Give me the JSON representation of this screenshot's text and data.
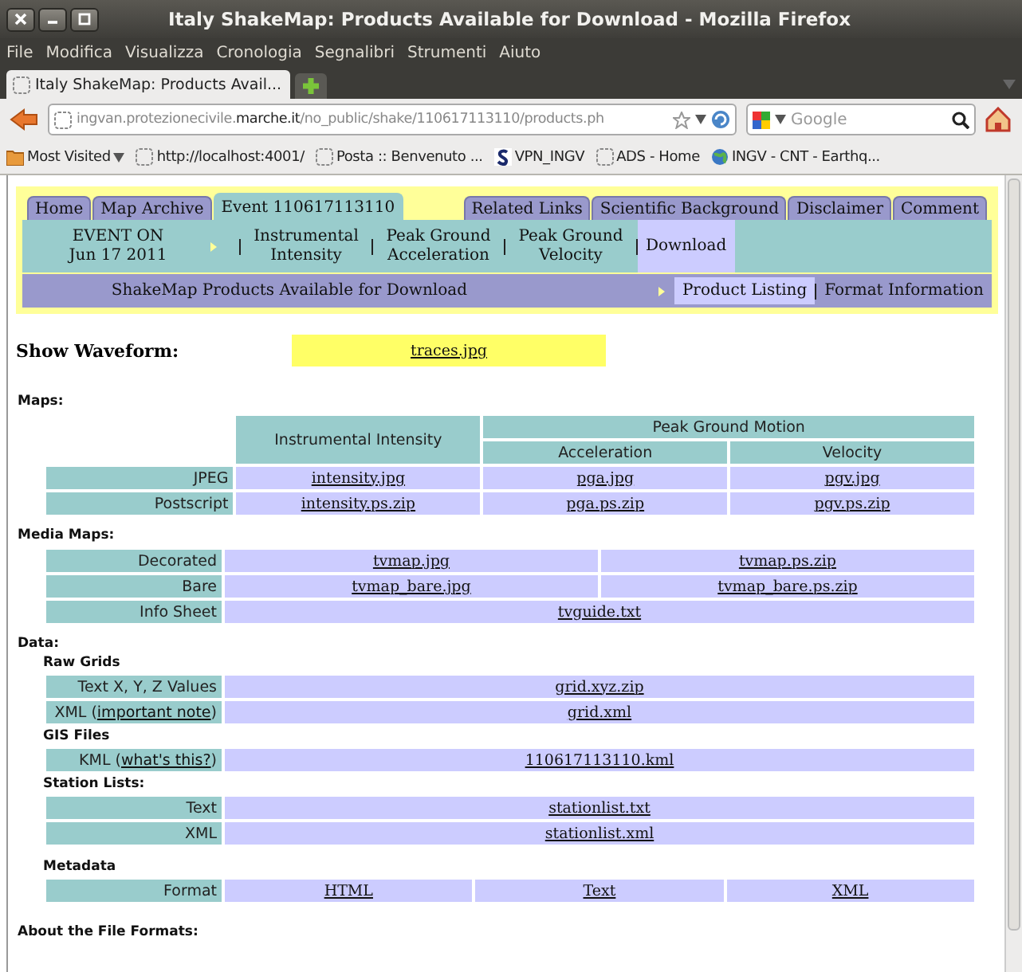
{
  "window": {
    "title": "Italy ShakeMap: Products Available for Download - Mozilla Firefox"
  },
  "menu": [
    "File",
    "Modifica",
    "Visualizza",
    "Cronologia",
    "Segnalibri",
    "Strumenti",
    "Aiuto"
  ],
  "browser_tabs": [
    {
      "label": "Italy ShakeMap: Products Avail...",
      "selected": true
    }
  ],
  "address": {
    "prefix": "ingvan.protezionecivile.",
    "domain": "marche.it",
    "path": "/no_public/shake/110617113110/products.ph"
  },
  "search": {
    "placeholder": "Google"
  },
  "bookmarks": [
    {
      "label": "Most Visited",
      "kind": "folder"
    },
    {
      "label": "http://localhost:4001/",
      "kind": "page"
    },
    {
      "label": "Posta :: Benvenuto ...",
      "kind": "page"
    },
    {
      "label": "VPN_INGV",
      "kind": "vpn"
    },
    {
      "label": "ADS - Home",
      "kind": "page"
    },
    {
      "label": "INGV - CNT - Earthq...",
      "kind": "globe"
    }
  ],
  "site_tabs": {
    "left": [
      {
        "label": "Home",
        "selected": false
      },
      {
        "label": "Map Archive",
        "selected": false
      },
      {
        "label": "Event 110617113110",
        "selected": true
      }
    ],
    "right": [
      {
        "label": "Related Links",
        "selected": false
      },
      {
        "label": "Scientific Background",
        "selected": false
      },
      {
        "label": "Disclaimer",
        "selected": false
      },
      {
        "label": "Comment",
        "selected": false
      }
    ]
  },
  "event_nav": {
    "event_lines": [
      "EVENT ON",
      "Jun 17 2011"
    ],
    "items": [
      {
        "label": "Instrumental Intensity",
        "selected": false
      },
      {
        "label": "Peak Ground Acceleration",
        "selected": false
      },
      {
        "label": "Peak Ground Velocity",
        "selected": false
      },
      {
        "label": "Download",
        "selected": true
      }
    ]
  },
  "sub_nav": {
    "title": "ShakeMap Products Available for Download",
    "items": [
      {
        "label": "Product Listing",
        "selected": true
      },
      {
        "label": "Format Information",
        "selected": false
      }
    ]
  },
  "waveform": {
    "label": "Show Waveform:",
    "link": "traces.jpg"
  },
  "maps": {
    "heading": "Maps:",
    "header": {
      "first": "Instrumental Intensity",
      "group": "Peak Ground Motion",
      "sub": [
        "Acceleration",
        "Velocity"
      ]
    },
    "rows": [
      {
        "label": [
          {
            "text": "JPEG"
          }
        ],
        "links": [
          "intensity.jpg",
          "pga.jpg",
          "pgv.jpg"
        ]
      },
      {
        "label": [
          {
            "text": "Postscript"
          }
        ],
        "links": [
          "intensity.ps.zip",
          "pga.ps.zip",
          "pgv.ps.zip"
        ]
      }
    ]
  },
  "media_maps": {
    "heading": "Media Maps:",
    "rows": [
      {
        "label": [
          {
            "text": "Decorated"
          }
        ],
        "links": [
          "tvmap.jpg",
          "tvmap.ps.zip"
        ]
      },
      {
        "label": [
          {
            "text": "Bare"
          }
        ],
        "links": [
          "tvmap_bare.jpg",
          "tvmap_bare.ps.zip"
        ]
      },
      {
        "label": [
          {
            "text": "Info Sheet"
          }
        ],
        "links": [
          "tvguide.txt"
        ]
      }
    ]
  },
  "data": {
    "heading": "Data:",
    "groups": [
      {
        "title": "Raw Grids",
        "rows": [
          {
            "label": [
              {
                "text": "Text X, Y, Z Values"
              }
            ],
            "links": [
              "grid.xyz.zip"
            ]
          },
          {
            "label": [
              {
                "text": "XML ("
              },
              {
                "link": "important note"
              },
              {
                "text": ")"
              }
            ],
            "links": [
              "grid.xml"
            ]
          }
        ]
      },
      {
        "title": "GIS Files",
        "rows": [
          {
            "label": [
              {
                "text": "KML ("
              },
              {
                "link": "what's this?"
              },
              {
                "text": ")"
              }
            ],
            "links": [
              "110617113110.kml"
            ]
          }
        ]
      },
      {
        "title": "Station Lists:",
        "rows": [
          {
            "label": [
              {
                "text": "Text"
              }
            ],
            "links": [
              "stationlist.txt"
            ]
          },
          {
            "label": [
              {
                "text": "XML"
              }
            ],
            "links": [
              "stationlist.xml"
            ]
          }
        ]
      },
      {
        "title": "Metadata",
        "rows": [
          {
            "label": [
              {
                "text": "Format"
              }
            ],
            "links": [
              "HTML",
              "Text",
              "XML"
            ]
          }
        ]
      }
    ]
  },
  "about": {
    "heading": "About the File Formats:"
  }
}
